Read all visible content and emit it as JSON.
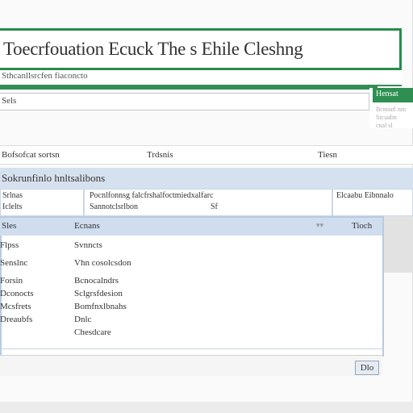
{
  "header": {
    "title": "Toecrfouation Ecuck The s Ehile Cleshng",
    "subtitle": "Sthcanllsrcfen fiaconcto"
  },
  "search": {
    "value": "Sels"
  },
  "side_panel": {
    "label": "Hensat",
    "lines": [
      "Bcnoatl nm",
      "Stcuabn",
      "cnal sl"
    ]
  },
  "columns": [
    "Bofsofcat sortsn",
    "Trdsnis",
    "Tiesn"
  ],
  "section": {
    "title": "Sokrunfinlo hnltsalibons"
  },
  "cells": {
    "left": [
      "Srlnas",
      "Iclelts"
    ],
    "middle": [
      "Pocnlfonnsg falcfrshalfoctmiedxalfarc",
      "Sannotclsrlbon",
      "Sf"
    ],
    "right": "Elcaabu Eibnnalo"
  },
  "dialog": {
    "head_left": "Sles",
    "head_mid": "Ecnans",
    "head_right": "Tioch",
    "rows": [
      {
        "key": "Flpss",
        "value": "Svnncts"
      },
      {
        "key": "Senslnc",
        "value": "Vhn cosolcsdon"
      },
      {
        "key": "Forsin",
        "value": "Bcnocalndrs"
      },
      {
        "key": "Dconocts",
        "value": "Sclgrsfdesion"
      },
      {
        "key": "Mcsfrets",
        "value": "Bomfnxlbnahs"
      },
      {
        "key": "Dreaubfs",
        "value": "Dnlc"
      },
      {
        "key": "",
        "value": "Chesdcare"
      }
    ],
    "ok_label": "Dlo"
  }
}
